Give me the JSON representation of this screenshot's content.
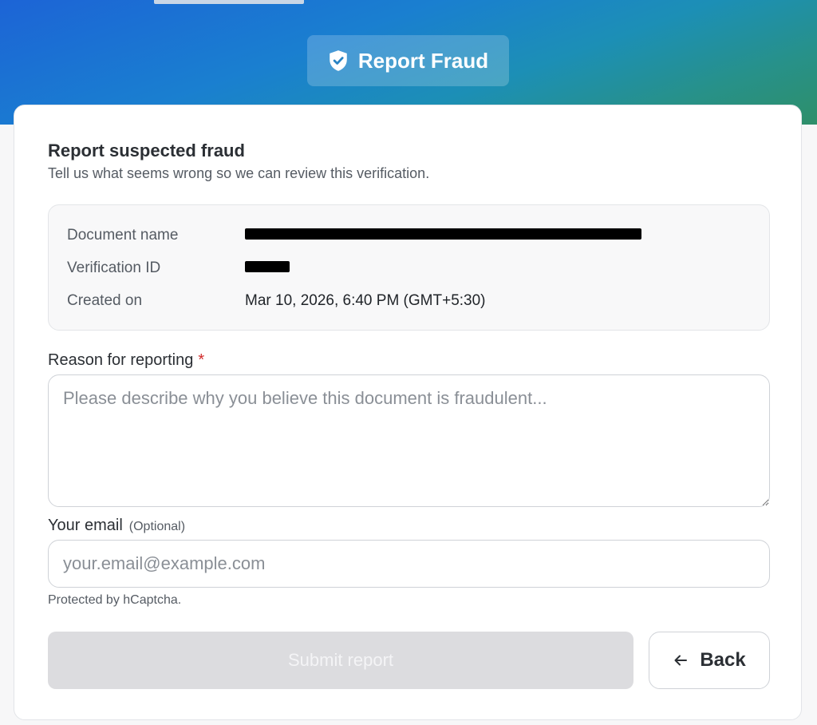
{
  "header": {
    "badge_label": "Report Fraud",
    "badge_icon": "shield-check-icon"
  },
  "card": {
    "title": "Report suspected fraud",
    "subtitle": "Tell us what seems wrong so we can review this verification."
  },
  "document_info": {
    "rows": [
      {
        "label": "Document name",
        "value": "[redacted]"
      },
      {
        "label": "Verification ID",
        "value": "[redacted]"
      },
      {
        "label": "Created on",
        "value": "Mar 10, 2026, 6:40 PM (GMT+5:30)"
      }
    ]
  },
  "form": {
    "reason_label": "Reason for reporting",
    "reason_required_marker": "*",
    "reason_placeholder": "Please describe why you believe this document is fraudulent...",
    "reason_value": "",
    "email_label": "Your email",
    "email_optional": "(Optional)",
    "email_placeholder": "your.email@example.com",
    "email_value": "",
    "captcha_note": "Protected by hCaptcha.",
    "submit_label": "Submit report",
    "submit_disabled": true,
    "back_label": "Back",
    "back_icon": "arrow-left-icon"
  },
  "colors": {
    "hero_gradient_start": "#1c64d6",
    "hero_gradient_end": "#2e8f6a",
    "required": "#d12b2b",
    "submit_disabled_bg": "#dcdcdf"
  }
}
